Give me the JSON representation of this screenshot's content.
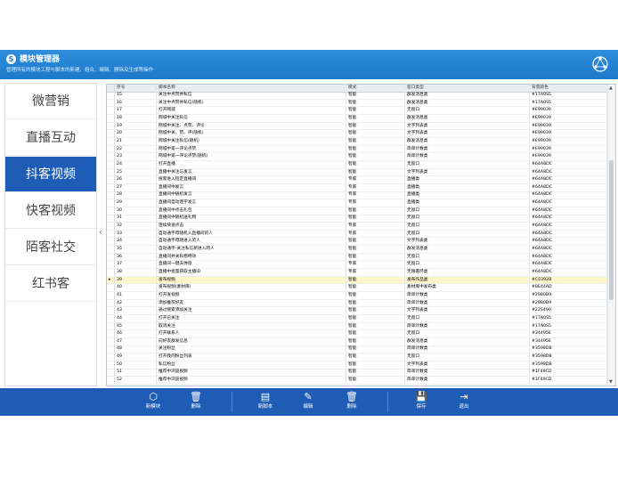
{
  "header": {
    "title": "模块管理器",
    "subtitle": "管理所有的模块工程与脚本的新建、组合、编辑、删除及生成等操作"
  },
  "sidebar": {
    "items": [
      {
        "label": "微营销"
      },
      {
        "label": "直播互动"
      },
      {
        "label": "抖客视频"
      },
      {
        "label": "快客视频"
      },
      {
        "label": "陌客社交"
      },
      {
        "label": "红书客"
      }
    ]
  },
  "grid": {
    "headers": [
      "",
      "序号",
      "脚本名称",
      "模式",
      "窗口类型",
      "背景颜色"
    ],
    "rows": [
      {
        "marker": "",
        "id": "15",
        "name": "关注中点赞并私信",
        "mode": "智能",
        "win": "群发消息类",
        "color": "#17A0S5"
      },
      {
        "marker": "",
        "id": "16",
        "name": "关注中点赞并私信(随机)",
        "mode": "智能",
        "win": "群发消息类",
        "color": "#17A0S5"
      },
      {
        "marker": "",
        "id": "17",
        "name": "打开网城",
        "mode": "智能",
        "win": "无窗口",
        "color": "#E99039"
      },
      {
        "marker": "",
        "id": "18",
        "name": "网城中关注私信",
        "mode": "智能",
        "win": "群发消息类",
        "color": "#E99039"
      },
      {
        "marker": "",
        "id": "19",
        "name": "网城中关注、点赞、评论",
        "mode": "智能",
        "win": "文字列表类",
        "color": "#E99039"
      },
      {
        "marker": "",
        "id": "20",
        "name": "网城中关、赞、评(随机)",
        "mode": "智能",
        "win": "文字列表类",
        "color": "#E99039"
      },
      {
        "marker": "",
        "id": "21",
        "name": "网城中关注私信(随机)",
        "mode": "智能",
        "win": "群发消息类",
        "color": "#E99039"
      },
      {
        "marker": "",
        "id": "22",
        "name": "网城中第一评论点赞",
        "mode": "智能",
        "win": "简单计数类",
        "color": "#E99039"
      },
      {
        "marker": "",
        "id": "23",
        "name": "网城中第一评论点赞(随机)",
        "mode": "智能",
        "win": "简单计数类",
        "color": "#E99039"
      },
      {
        "marker": "",
        "id": "24",
        "name": "打开直播",
        "mode": "智能",
        "win": "无窗口",
        "color": "#64A8DC"
      },
      {
        "marker": "",
        "id": "25",
        "name": "直播中关注与发言",
        "mode": "智能",
        "win": "文字列表类",
        "color": "#64A8DC"
      },
      {
        "marker": "",
        "id": "26",
        "name": "搜索进入指定直播间",
        "mode": "专家",
        "win": "直播类",
        "color": "#64A8DC"
      },
      {
        "marker": "",
        "id": "27",
        "name": "直播间中发言",
        "mode": "专家",
        "win": "直播类",
        "color": "#64A8DC"
      },
      {
        "marker": "",
        "id": "28",
        "name": "直播间中随机发言",
        "mode": "专家",
        "win": "直播类",
        "color": "#64A8DC"
      },
      {
        "marker": "",
        "id": "29",
        "name": "直播间自动连字发言",
        "mode": "专家",
        "win": "直播类",
        "color": "#64A8DC"
      },
      {
        "marker": "",
        "id": "30",
        "name": "直播间中点击礼包",
        "mode": "智能",
        "win": "无窗口",
        "color": "#64A8DC"
      },
      {
        "marker": "",
        "id": "31",
        "name": "直播间中随机送礼物",
        "mode": "智能",
        "win": "无窗口",
        "color": "#64A8DC"
      },
      {
        "marker": "",
        "id": "32",
        "name": "连续快速点击",
        "mode": "专家",
        "win": "无窗口",
        "color": "#64A8DC"
      },
      {
        "marker": "",
        "id": "33",
        "name": "自动通字母随机入直播间的人",
        "mode": "专家",
        "win": "无窗口",
        "color": "#64A8DC"
      },
      {
        "marker": "",
        "id": "34",
        "name": "自动通字母随进入的人",
        "mode": "智能",
        "win": "文字列表类",
        "color": "#64A8DC"
      },
      {
        "marker": "",
        "id": "35",
        "name": "自动通字-关注私信新进入的人",
        "mode": "智能",
        "win": "群发消息类",
        "color": "#64A8DC"
      },
      {
        "marker": "",
        "id": "36",
        "name": "直播间并关私物特效",
        "mode": "智能",
        "win": "无窗口",
        "color": "#64A8DC"
      },
      {
        "marker": "",
        "id": "37",
        "name": "直播间一键去弹窗",
        "mode": "专家",
        "win": "无窗口",
        "color": "#64A8DC"
      },
      {
        "marker": "",
        "id": "38",
        "name": "直播中批量获取主播ID",
        "mode": "专家",
        "win": "无限循环类",
        "color": "#64A8DC"
      },
      {
        "marker": "▸",
        "id": "39",
        "name": "发布视频",
        "mode": "智能",
        "win": "发布作品类",
        "color": "#C0392B"
      },
      {
        "marker": "",
        "id": "40",
        "name": "发布视频(素材库)",
        "mode": "智能",
        "win": "素材库中发布类",
        "color": "#8E44AD"
      },
      {
        "marker": "",
        "id": "41",
        "name": "打开发视频",
        "mode": "智能",
        "win": "简单计数类",
        "color": "#2980B9"
      },
      {
        "marker": "",
        "id": "42",
        "name": "添加推荐好友",
        "mode": "智能",
        "win": "简单计数类",
        "color": "#2980B9"
      },
      {
        "marker": "",
        "id": "43",
        "name": "通过搜索添加关注",
        "mode": "智能",
        "win": "文字列表类",
        "color": "#22S490"
      },
      {
        "marker": "",
        "id": "44",
        "name": "打开已关注",
        "mode": "智能",
        "win": "无窗口",
        "color": "#17A0S5"
      },
      {
        "marker": "",
        "id": "45",
        "name": "取消关注",
        "mode": "智能",
        "win": "简单计数类",
        "color": "#17A0S5"
      },
      {
        "marker": "",
        "id": "46",
        "name": "打开联系人",
        "mode": "智能",
        "win": "无窗口",
        "color": "#34495E"
      },
      {
        "marker": "",
        "id": "47",
        "name": "向好友群发信息",
        "mode": "智能",
        "win": "群发消息类",
        "color": "#34495E"
      },
      {
        "marker": "",
        "id": "48",
        "name": "关注粉丝",
        "mode": "智能",
        "win": "简单计数类",
        "color": "#3598DB"
      },
      {
        "marker": "",
        "id": "49",
        "name": "打开我的粉丝列表",
        "mode": "智能",
        "win": "无窗口",
        "color": "#3598DB"
      },
      {
        "marker": "",
        "id": "50",
        "name": "私信粉丝",
        "mode": "智能",
        "win": "文字列表类",
        "color": "#3598DB"
      },
      {
        "marker": "",
        "id": "51",
        "name": "推荐中浏览视频",
        "mode": "智能",
        "win": "简单计数类",
        "color": "#1F49CD"
      },
      {
        "marker": "",
        "id": "52",
        "name": "推荐中浏览视频",
        "mode": "智能",
        "win": "简单计数类",
        "color": "#1F49CD"
      }
    ]
  },
  "toolbar": {
    "new_module": "新模块",
    "delete1": "删除",
    "new_script": "新脚本",
    "edit": "编辑",
    "delete2": "删除",
    "save": "保存",
    "exit": "退出"
  }
}
